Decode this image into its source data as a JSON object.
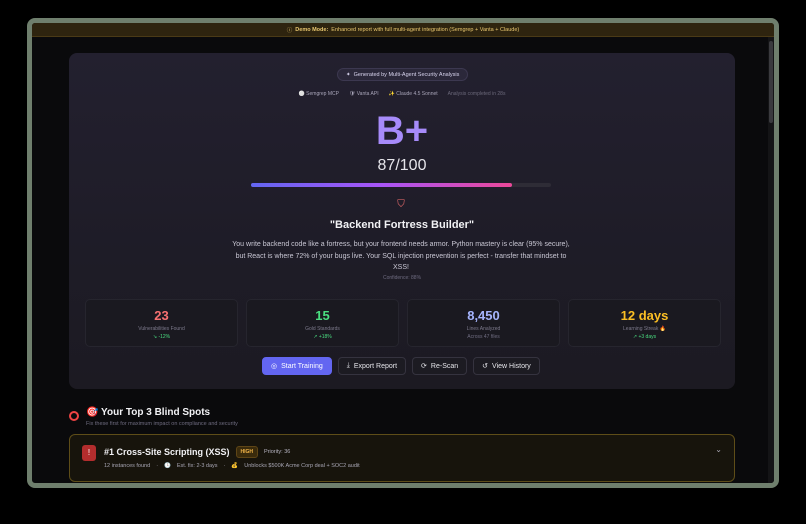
{
  "banner": {
    "bold": "Demo Mode:",
    "text": "Enhanced report with full multi-agent integration (Semgrep + Vanta + Claude)"
  },
  "hero": {
    "badge": "Generated by Multi-Agent Security Analysis",
    "tools": [
      "Semgrep MCP",
      "Vanta API",
      "Claude 4.5 Sonnet"
    ],
    "completed": "Analysis completed in 28s",
    "grade": "B+",
    "score": "87/100",
    "score_fraction": 0.87,
    "persona": "\"Backend Fortress Builder\"",
    "description": "You write backend code like a fortress, but your frontend needs armor. Python mastery is clear (95% secure), but React is where 72% of your bugs live. Your SQL injection prevention is perfect - transfer that mindset to XSS!",
    "confidence": "Confidence: 88%"
  },
  "stats": [
    {
      "value": "23",
      "label": "Vulnerabilities Found",
      "delta": "↘ -12%",
      "color": "#f87171",
      "delta_color": "#4ade80"
    },
    {
      "value": "15",
      "label": "Gold Standards",
      "delta": "↗ +18%",
      "color": "#4ade80",
      "delta_color": "#4ade80"
    },
    {
      "value": "8,450",
      "label": "Lines Analyzed",
      "delta": "Across 47 files",
      "color": "#a5b4fc",
      "delta_color": "#6f6c80"
    },
    {
      "value": "12 days",
      "label": "Learning Streak 🔥",
      "delta": "↗ +3 days",
      "color": "#fbbf24",
      "delta_color": "#4ade80"
    }
  ],
  "actions": {
    "start": "Start Training",
    "export": "Export Report",
    "rescan": "Re-Scan",
    "history": "View History"
  },
  "blind_spots": {
    "title": "🎯 Your Top 3 Blind Spots",
    "subtitle": "Fix these first for maximum impact on compliance and security",
    "items": [
      {
        "title": "#1 Cross-Site Scripting (XSS)",
        "severity": "HIGH",
        "priority": "Priority: 36",
        "instances": "12 instances found",
        "fix": "Est. fix: 2-3 days",
        "impact": "Unblocks $500K Acme Corp deal + SOC2 audit"
      }
    ]
  }
}
